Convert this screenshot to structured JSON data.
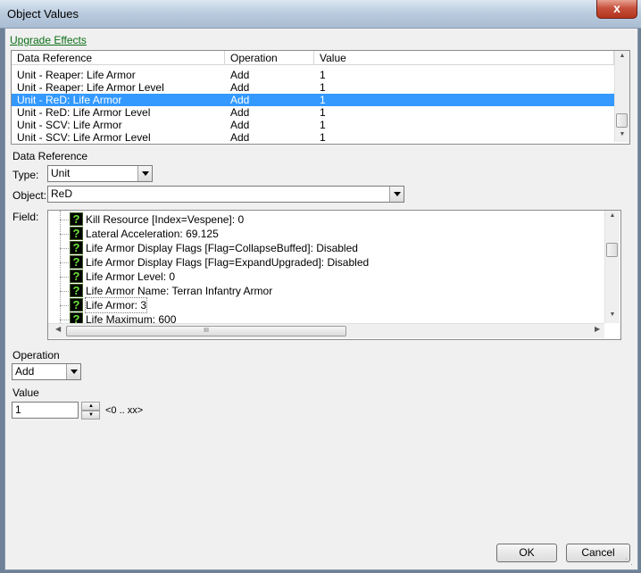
{
  "window": {
    "title": "Object Values",
    "close_glyph": "x"
  },
  "upgrade_effects_link": "Upgrade Effects",
  "effects_table": {
    "columns": [
      "Data Reference",
      "Operation",
      "Value"
    ],
    "rows": [
      {
        "ref": "Unit - Reaper: Life Armor",
        "op": "Add",
        "val": "1"
      },
      {
        "ref": "Unit - Reaper: Life Armor Level",
        "op": "Add",
        "val": "1"
      },
      {
        "ref": "Unit - ReD: Life Armor",
        "op": "Add",
        "val": "1"
      },
      {
        "ref": "Unit - ReD: Life Armor Level",
        "op": "Add",
        "val": "1"
      },
      {
        "ref": "Unit - SCV: Life Armor",
        "op": "Add",
        "val": "1"
      },
      {
        "ref": "Unit - SCV: Life Armor Level",
        "op": "Add",
        "val": "1"
      }
    ],
    "selected_index": 2
  },
  "data_reference": {
    "heading": "Data Reference",
    "type_label": "Type:",
    "type_value": "Unit",
    "object_label": "Object:",
    "object_value": "ReD",
    "field_label": "Field:"
  },
  "fields": [
    "Kill Resource [Index=Vespene]: 0",
    "Lateral Acceleration: 69.125",
    "Life Armor Display Flags [Flag=CollapseBuffed]: Disabled",
    "Life Armor Display Flags [Flag=ExpandUpgraded]: Disabled",
    "Life Armor Level: 0",
    "Life Armor Name: Terran Infantry Armor",
    "Life Armor: 3",
    "Life Maximum: 600"
  ],
  "field_selected_index": 6,
  "horizontal_scroll_grip": "III",
  "operation": {
    "label": "Operation",
    "value": "Add"
  },
  "value": {
    "label": "Value",
    "current": "1",
    "range_hint": "<0 .. xx>"
  },
  "buttons": {
    "ok": "OK",
    "cancel": "Cancel"
  },
  "icons": {
    "field_icon": "question-mark-icon"
  }
}
